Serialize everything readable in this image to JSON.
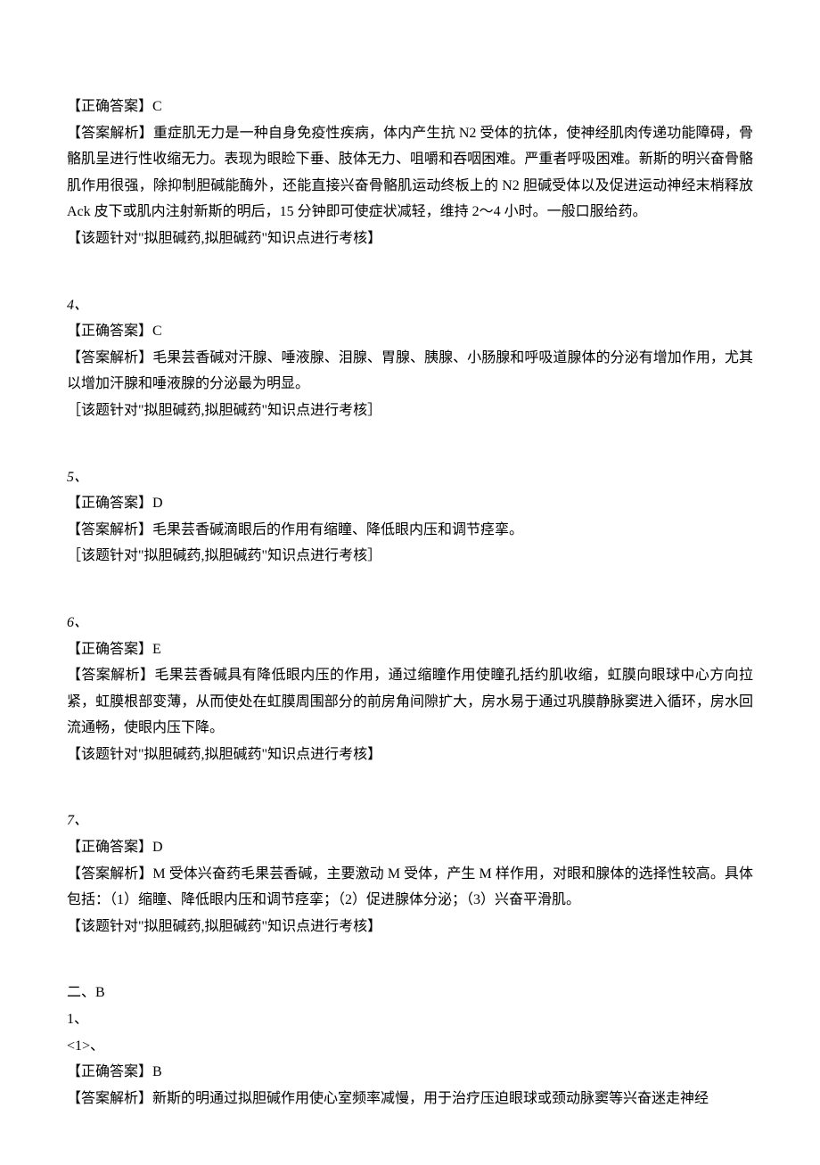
{
  "blocks": [
    {
      "correct": "【正确答案】C",
      "analysis": "【答案解析】重症肌无力是一种自身免疫性疾病，体内产生抗 N2 受体的抗体，使神经肌肉传递功能障碍，骨骼肌呈进行性收缩无力。表现为眼睑下垂、肢体无力、咀嚼和吞咽困难。严重者呼吸困难。新斯的明兴奋骨骼肌作用很强，除抑制胆碱能酶外，还能直接兴奋骨骼肌运动终板上的 N2 胆碱受体以及促进运动神经末梢释放 Ack 皮下或肌内注射新斯的明后，15 分钟即可使症状减轻，维持 2～4 小时。一般口服给药。",
      "note": "【该题针对\"拟胆碱药,拟胆碱药\"知识点进行考核】"
    },
    {
      "num": "4、",
      "correct": "【正确答案】C",
      "analysis": "【答案解析】毛果芸香碱对汗腺、唾液腺、泪腺、胃腺、胰腺、小肠腺和呼吸道腺体的分泌有增加作用，尤其以增加汗腺和唾液腺的分泌最为明显。",
      "note": "［该题针对\"拟胆碱药,拟胆碱药\"知识点进行考核］"
    },
    {
      "num": "5、",
      "correct": "【正确答案】D",
      "analysis": "【答案解析】毛果芸香碱滴眼后的作用有缩瞳、降低眼内压和调节痉挛。",
      "note": "［该题针对\"拟胆碱药,拟胆碱药\"知识点进行考核］"
    },
    {
      "num": "6、",
      "correct": "【正确答案】E",
      "analysis": "【答案解析】毛果芸香碱具有降低眼内压的作用，通过缩瞳作用使瞳孔括约肌收缩，虹膜向眼球中心方向拉紧，虹膜根部变薄，从而使处在虹膜周围部分的前房角间隙扩大，房水易于通过巩膜静脉窦进入循环，房水回流通畅，使眼内压下降。",
      "note": "【该题针对\"拟胆碱药,拟胆碱药\"知识点进行考核】"
    },
    {
      "num": "7、",
      "correct": "【正确答案】D",
      "analysis": "【答案解析】M 受体兴奋药毛果芸香碱，主要激动 M 受体，产生 M 样作用，对眼和腺体的选择性较高。具体包括：（1）缩瞳、降低眼内压和调节痉挛；（2）促进腺体分泌；（3）兴奋平滑肌。",
      "note": "【该题针对\"拟胆碱药,拟胆碱药\"知识点进行考核】"
    }
  ],
  "sectionB": {
    "header": "二、B",
    "sub": "1、",
    "subsub": "<1>、",
    "correct": "【正确答案】B",
    "analysis": "【答案解析】新斯的明通过拟胆碱作用使心室频率减慢，用于治疗压迫眼球或颈动脉窦等兴奋迷走神经"
  }
}
